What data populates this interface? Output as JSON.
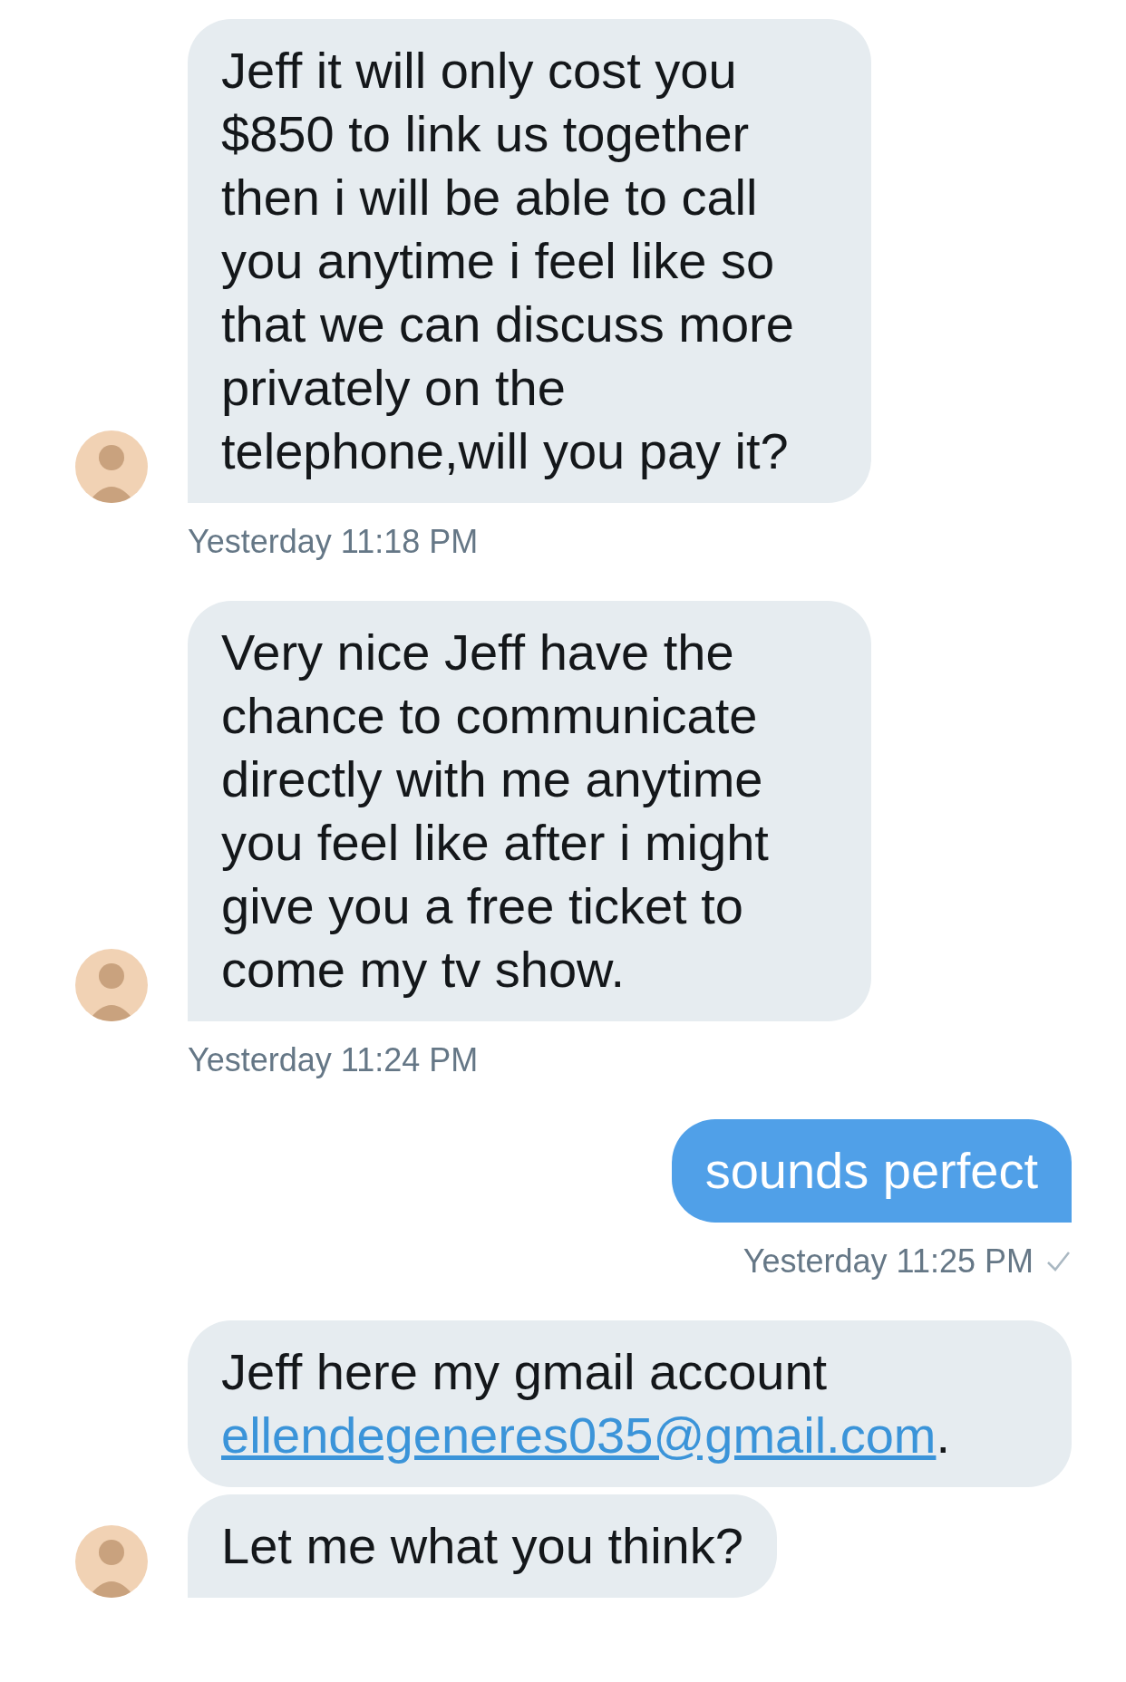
{
  "messages": [
    {
      "kind": "received",
      "bubbles": [
        {
          "text": "Jeff it will only cost you $850 to link us together then i will be able to call you anytime i feel like so that we can discuss more privately on the telephone,will you pay it?"
        }
      ],
      "time": "Yesterday 11:18 PM"
    },
    {
      "kind": "received",
      "bubbles": [
        {
          "text": "Very nice Jeff have the chance to communicate directly with me anytime you feel like after i might give you a free ticket to come my tv show."
        }
      ],
      "time": "Yesterday 11:24 PM"
    },
    {
      "kind": "sent",
      "bubbles": [
        {
          "text": "sounds perfect"
        }
      ],
      "time": "Yesterday 11:25 PM",
      "delivered": true
    },
    {
      "kind": "received",
      "bubbles": [
        {
          "text": "Jeff here my gmail account",
          "link": "ellendegeneres035@gmail.com",
          "after": "."
        },
        {
          "text": "Let me what you think?"
        }
      ]
    }
  ]
}
